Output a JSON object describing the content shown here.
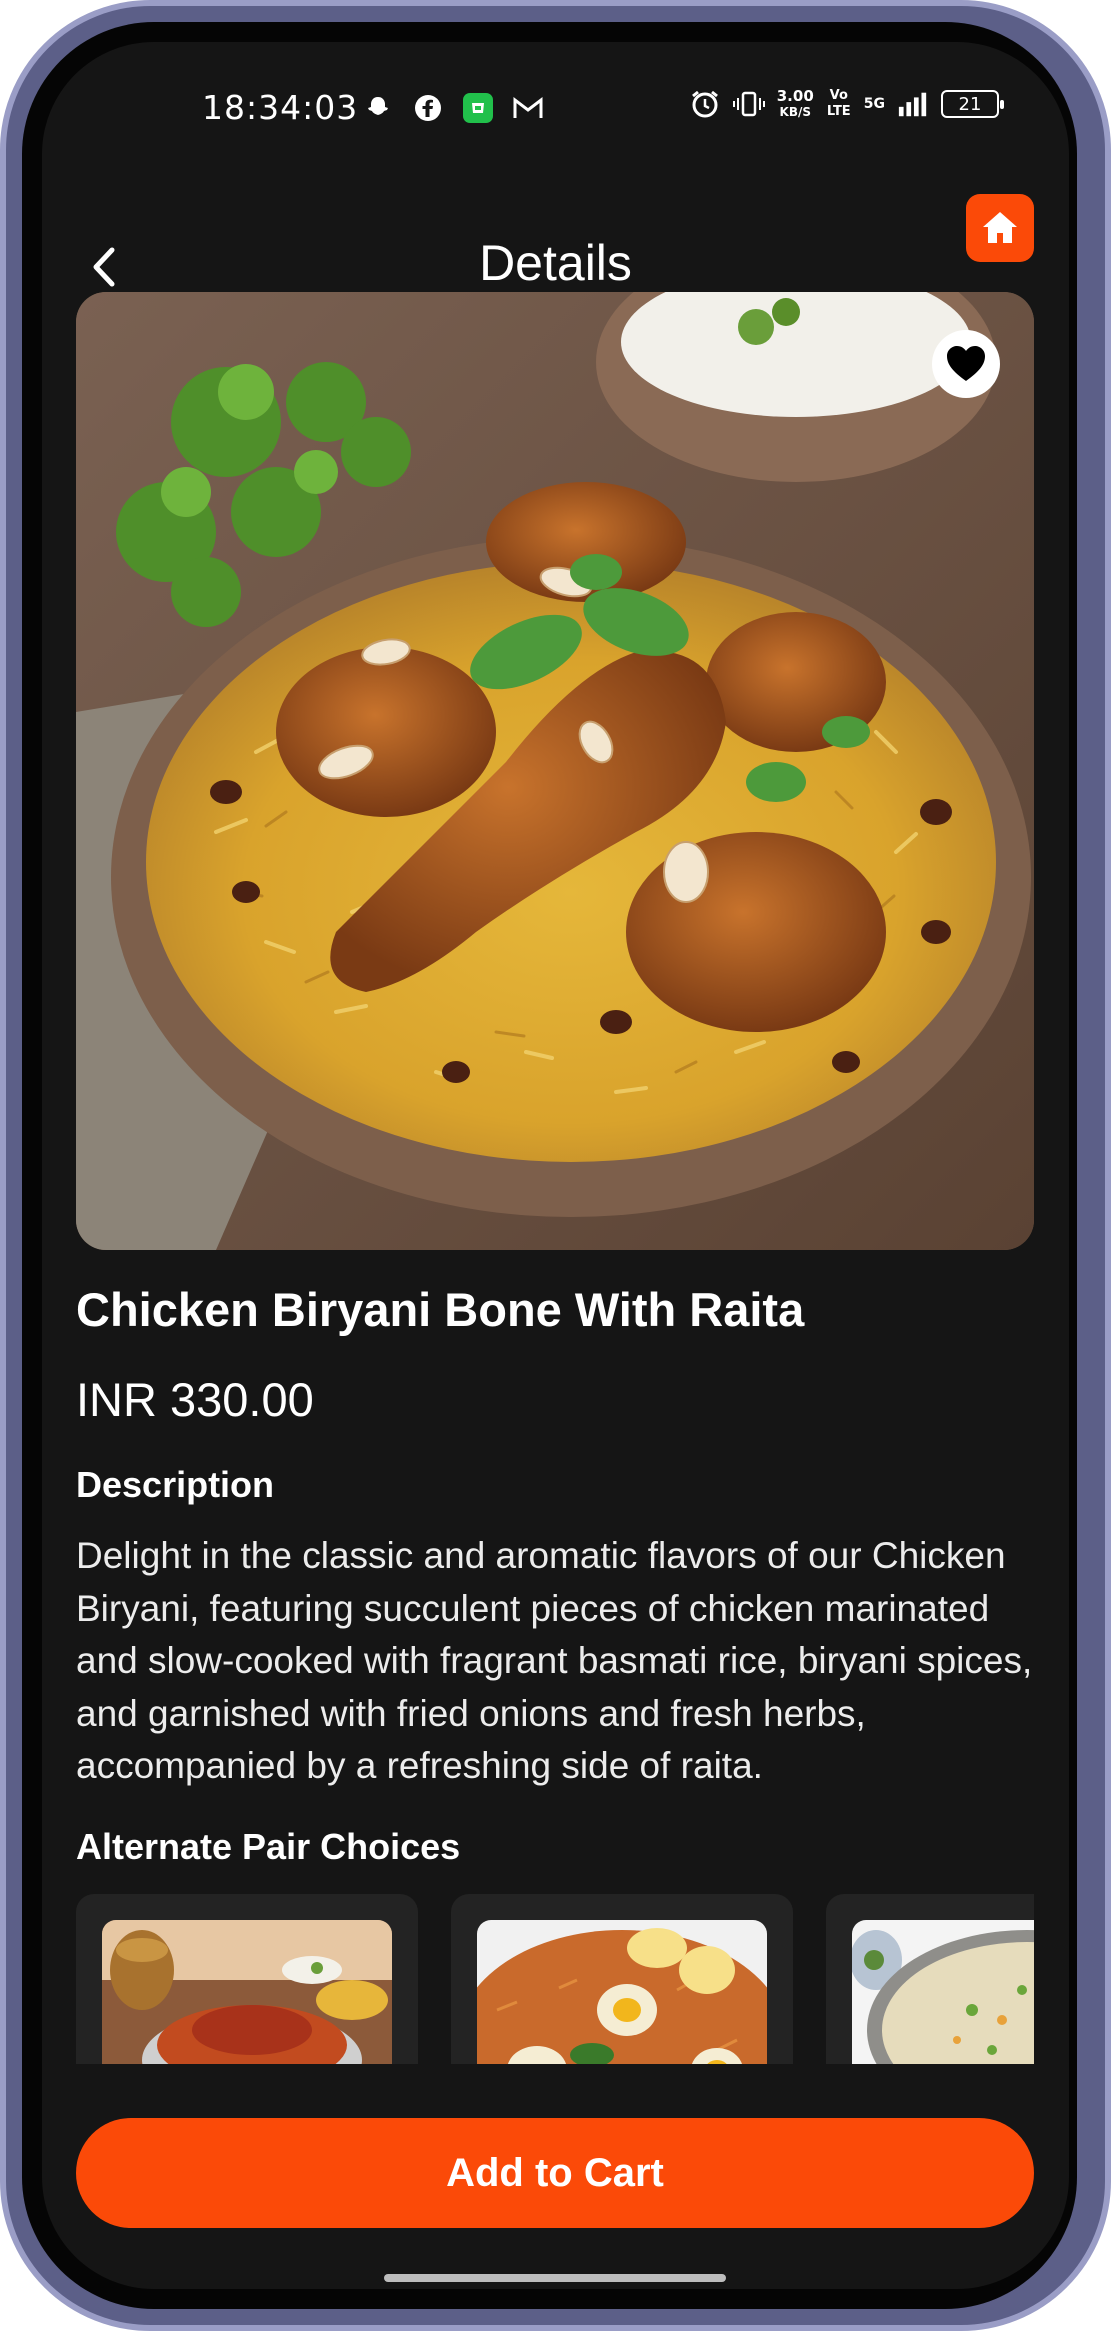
{
  "status_bar": {
    "time": "18:34:03",
    "net_speed": "3.00",
    "net_unit": "KB/S",
    "volte": "Vo LTE",
    "network": "5G",
    "battery": "21",
    "left_icons": [
      "snapchat-icon",
      "facebook-icon",
      "whatsapp-business-icon",
      "gmail-icon"
    ],
    "right_icons": [
      "alarm-icon",
      "vibrate-icon",
      "signal-icon"
    ]
  },
  "header": {
    "title": "Details",
    "back_icon": "chevron-left-icon",
    "home_icon": "home-icon"
  },
  "product": {
    "image_icon": "heart-icon",
    "name": "Chicken Biryani Bone With Raita",
    "price": "INR 330.00",
    "description_heading": "Description",
    "description": "Delight in the classic and aromatic flavors of our Chicken Biryani, featuring succulent pieces of chicken marinated and slow-cooked with fragrant basmati rice, biryani spices, and garnished with fried onions and fresh herbs, accompanied by a refreshing side of raita."
  },
  "pairs": {
    "heading": "Alternate Pair Choices"
  },
  "cta": {
    "label": "Add to Cart"
  },
  "colors": {
    "accent": "#fb4a08",
    "background": "#151515",
    "card": "#232323"
  }
}
